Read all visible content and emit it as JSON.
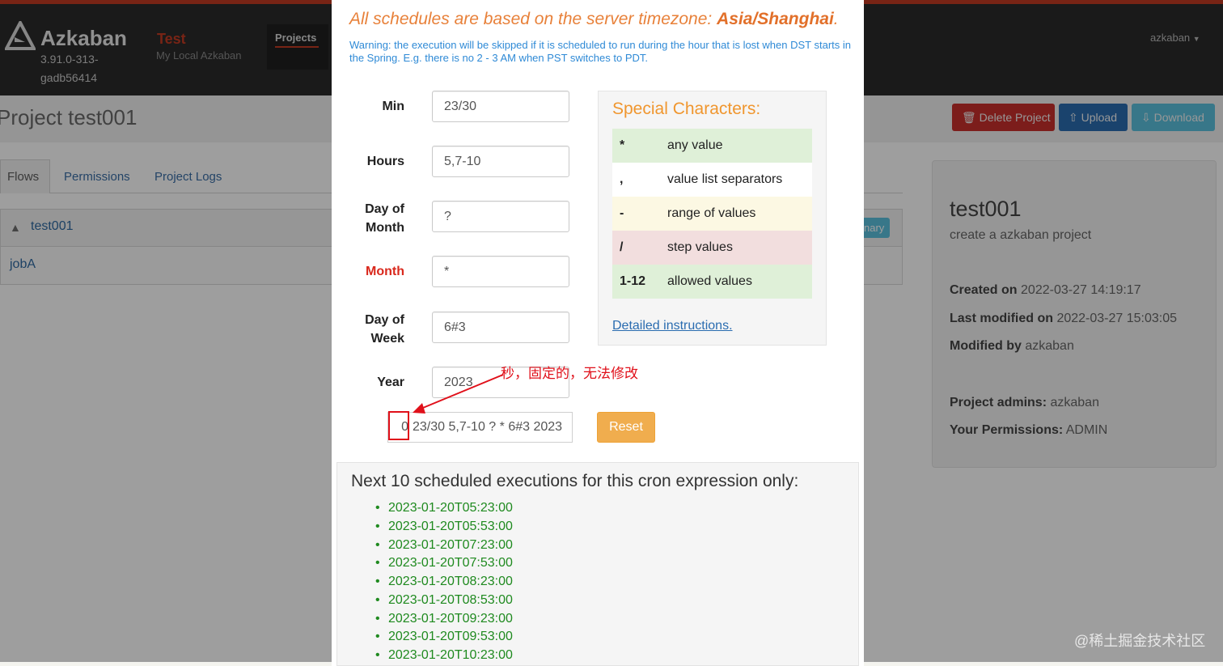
{
  "app": {
    "name": "Azkaban",
    "version": "3.91.0-313-\ngadb56414",
    "version_line1": "3.91.0-313-",
    "version_line2": "gadb56414",
    "env_name": "Test",
    "env_desc": "My Local Azkaban",
    "nav_projects": "Projects",
    "user": "azkaban",
    "accent_color": "#c23a22"
  },
  "project": {
    "title": "Project test001",
    "buttons": {
      "delete": "Delete Project",
      "upload": "Upload",
      "download": "Download"
    },
    "tabs": [
      "Flows",
      "Permissions",
      "Project Logs"
    ],
    "flow": "test001",
    "job": "jobA",
    "summary_tag": "nary",
    "card": {
      "name": "test001",
      "description": "create a azkaban project",
      "created_label": "Created on",
      "created": "2022-03-27 14:19:17",
      "modified_label": "Last modified on",
      "modified": "2022-03-27 15:03:05",
      "modified_by_label": "Modified by",
      "modified_by": "azkaban",
      "admins_label": "Project admins:",
      "admins": "azkaban",
      "perm_label": "Your Permissions:",
      "perm": "ADMIN"
    }
  },
  "modal": {
    "timezone_prefix": "All schedules are based on the server timezone:",
    "timezone": "Asia/Shanghai",
    "timezone_suffix": ".",
    "warning": "Warning: the execution will be skipped if it is scheduled to run during the hour that is lost when DST starts in the Spring. E.g. there is no 2 - 3 AM when PST switches to PDT.",
    "fields": {
      "min": {
        "label": "Min",
        "value": "23/30"
      },
      "hours": {
        "label": "Hours",
        "value": "5,7-10"
      },
      "day_of_month": {
        "label_1": "Day of",
        "label_2": "Month",
        "value": "?"
      },
      "month": {
        "label": "Month",
        "value": "*"
      },
      "day_of_week": {
        "label_1": "Day of",
        "label_2": "Week",
        "value": "6#3"
      },
      "year": {
        "label": "Year",
        "value": "2023"
      }
    },
    "special": {
      "title": "Special Characters:",
      "rows": [
        {
          "symbol": "*",
          "desc": "any value"
        },
        {
          "symbol": ",",
          "desc": "value list separators"
        },
        {
          "symbol": "-",
          "desc": "range of values"
        },
        {
          "symbol": "/",
          "desc": "step values"
        },
        {
          "symbol": "1-12",
          "desc": "allowed values"
        }
      ],
      "link": "Detailed instructions."
    },
    "cron_seconds": "0",
    "cron_expression": "23/30 5,7-10 ? * 6#3 2023",
    "annotation": "秒，固定的，无法修改",
    "reset": "Reset",
    "next_title": "Next 10 scheduled executions for this cron expression only:",
    "next_runs": [
      "2023-01-20T05:23:00",
      "2023-01-20T05:53:00",
      "2023-01-20T07:23:00",
      "2023-01-20T07:53:00",
      "2023-01-20T08:23:00",
      "2023-01-20T08:53:00",
      "2023-01-20T09:23:00",
      "2023-01-20T09:53:00",
      "2023-01-20T10:23:00"
    ]
  },
  "watermark": "@稀土掘金技术社区"
}
